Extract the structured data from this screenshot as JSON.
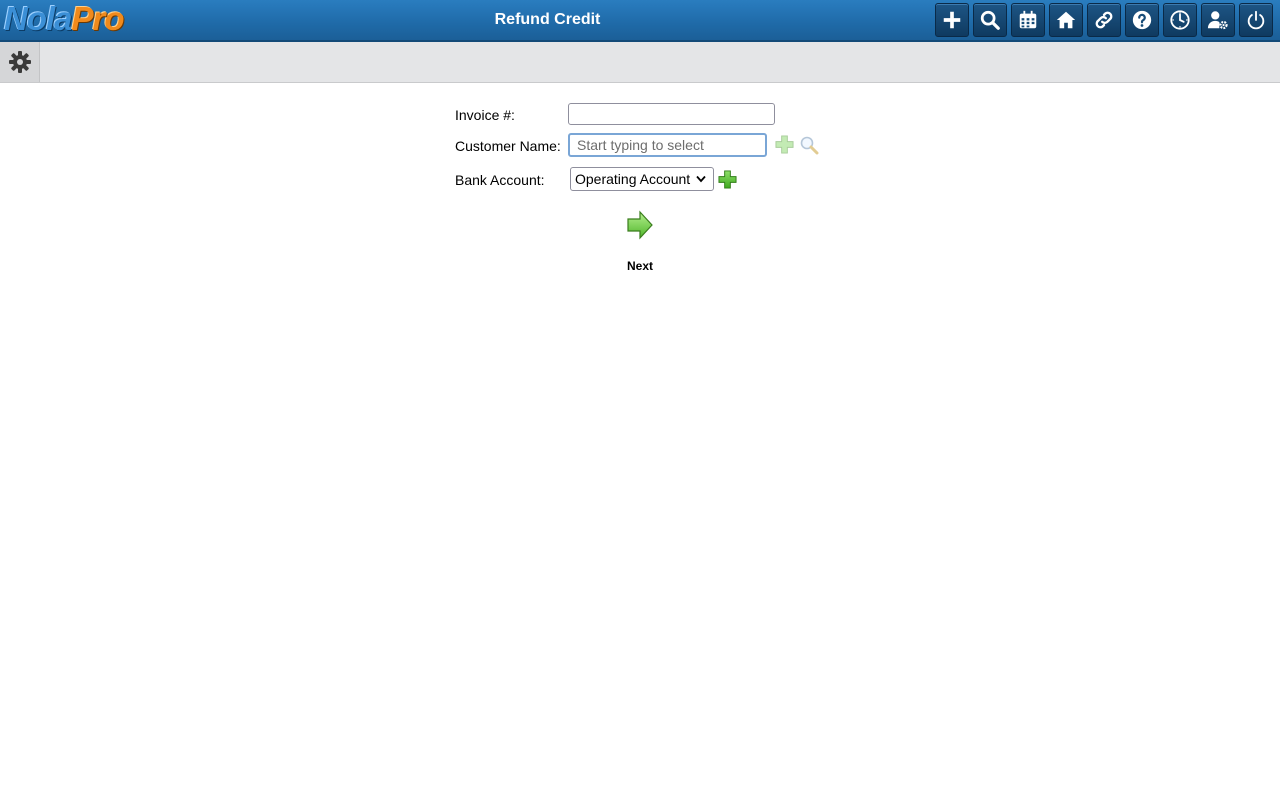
{
  "header": {
    "logo_part1": "Nola",
    "logo_part2": "Pro",
    "title": "Refund Credit",
    "buttons": [
      "plus-icon",
      "search-icon",
      "calendar-icon",
      "home-icon",
      "link-icon",
      "help-icon",
      "clock-icon",
      "user-settings-icon",
      "power-icon"
    ]
  },
  "subbar": {
    "icon": "gear-icon"
  },
  "form": {
    "invoice_label": "Invoice #:",
    "invoice_value": "",
    "customer_label": "Customer Name:",
    "customer_placeholder": "Start typing to select",
    "bank_label": "Bank Account:",
    "bank_selected": "Operating Account",
    "next_label": "Next"
  },
  "colors": {
    "header_bg": "#1f6aa8",
    "subbar_bg": "#e4e5e7",
    "add_green": "#4cb82f"
  }
}
